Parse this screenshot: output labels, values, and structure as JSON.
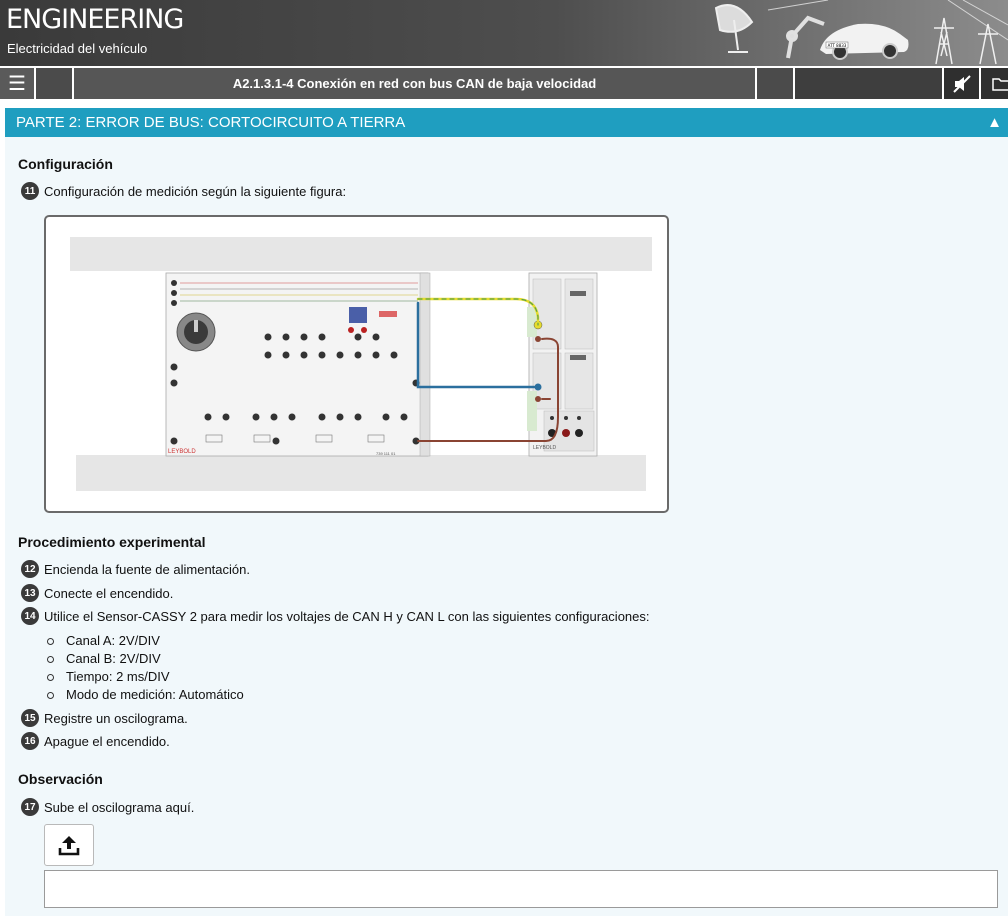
{
  "header": {
    "brand": "ENGINEERING",
    "subtitle": "Electricidad del vehículo",
    "car_plate": "ATT 8833"
  },
  "navbar": {
    "menu_icon": "hamburger-menu-icon",
    "title": "A2.1.3.1-4  Conexión en red con bus CAN de baja velocidad",
    "mute_icon": "speaker-muted-icon",
    "folder_icon": "folder-icon"
  },
  "section": {
    "title": "PARTE 2: ERROR DE BUS: CORTOCIRCUITO A TIERRA",
    "collapse_icon": "triangle-up-icon"
  },
  "config": {
    "heading": "Configuración",
    "step_num": "11",
    "step_text": "Configuración de medición según la siguiente figura:",
    "figure": {
      "brand_left": "LEYBOLD",
      "brand_right": "LEYBOLD",
      "part_number": "739 111 01",
      "wire_colors": {
        "can_high": "#e6dc2e",
        "can_low": "#2b6f9e",
        "ground": "#8a4433",
        "green_stripe": "#5aa14a"
      }
    }
  },
  "procedure": {
    "heading": "Procedimiento experimental",
    "steps": [
      {
        "num": "12",
        "text": "Encienda la fuente de alimentación."
      },
      {
        "num": "13",
        "text": "Conecte el encendido."
      },
      {
        "num": "14",
        "text": "Utilice el Sensor-CASSY 2 para medir los voltajes de CAN H y CAN L con las siguientes configuraciones:"
      },
      {
        "num": "15",
        "text": "Registre un oscilograma."
      },
      {
        "num": "16",
        "text": "Apague el encendido."
      }
    ],
    "settings": [
      "Canal A: 2V/DIV",
      "Canal B: 2V/DIV",
      "Tiempo: 2 ms/DIV",
      "Modo de medición: Automático"
    ]
  },
  "observation": {
    "heading": "Observación",
    "step_num": "17",
    "step_text": "Sube el oscilograma aquí.",
    "upload_icon": "upload-icon",
    "field_value": ""
  },
  "colors": {
    "accent": "#1f9ec0",
    "header_dark": "#4b4b4b",
    "content_bg": "#f1f8fb"
  }
}
